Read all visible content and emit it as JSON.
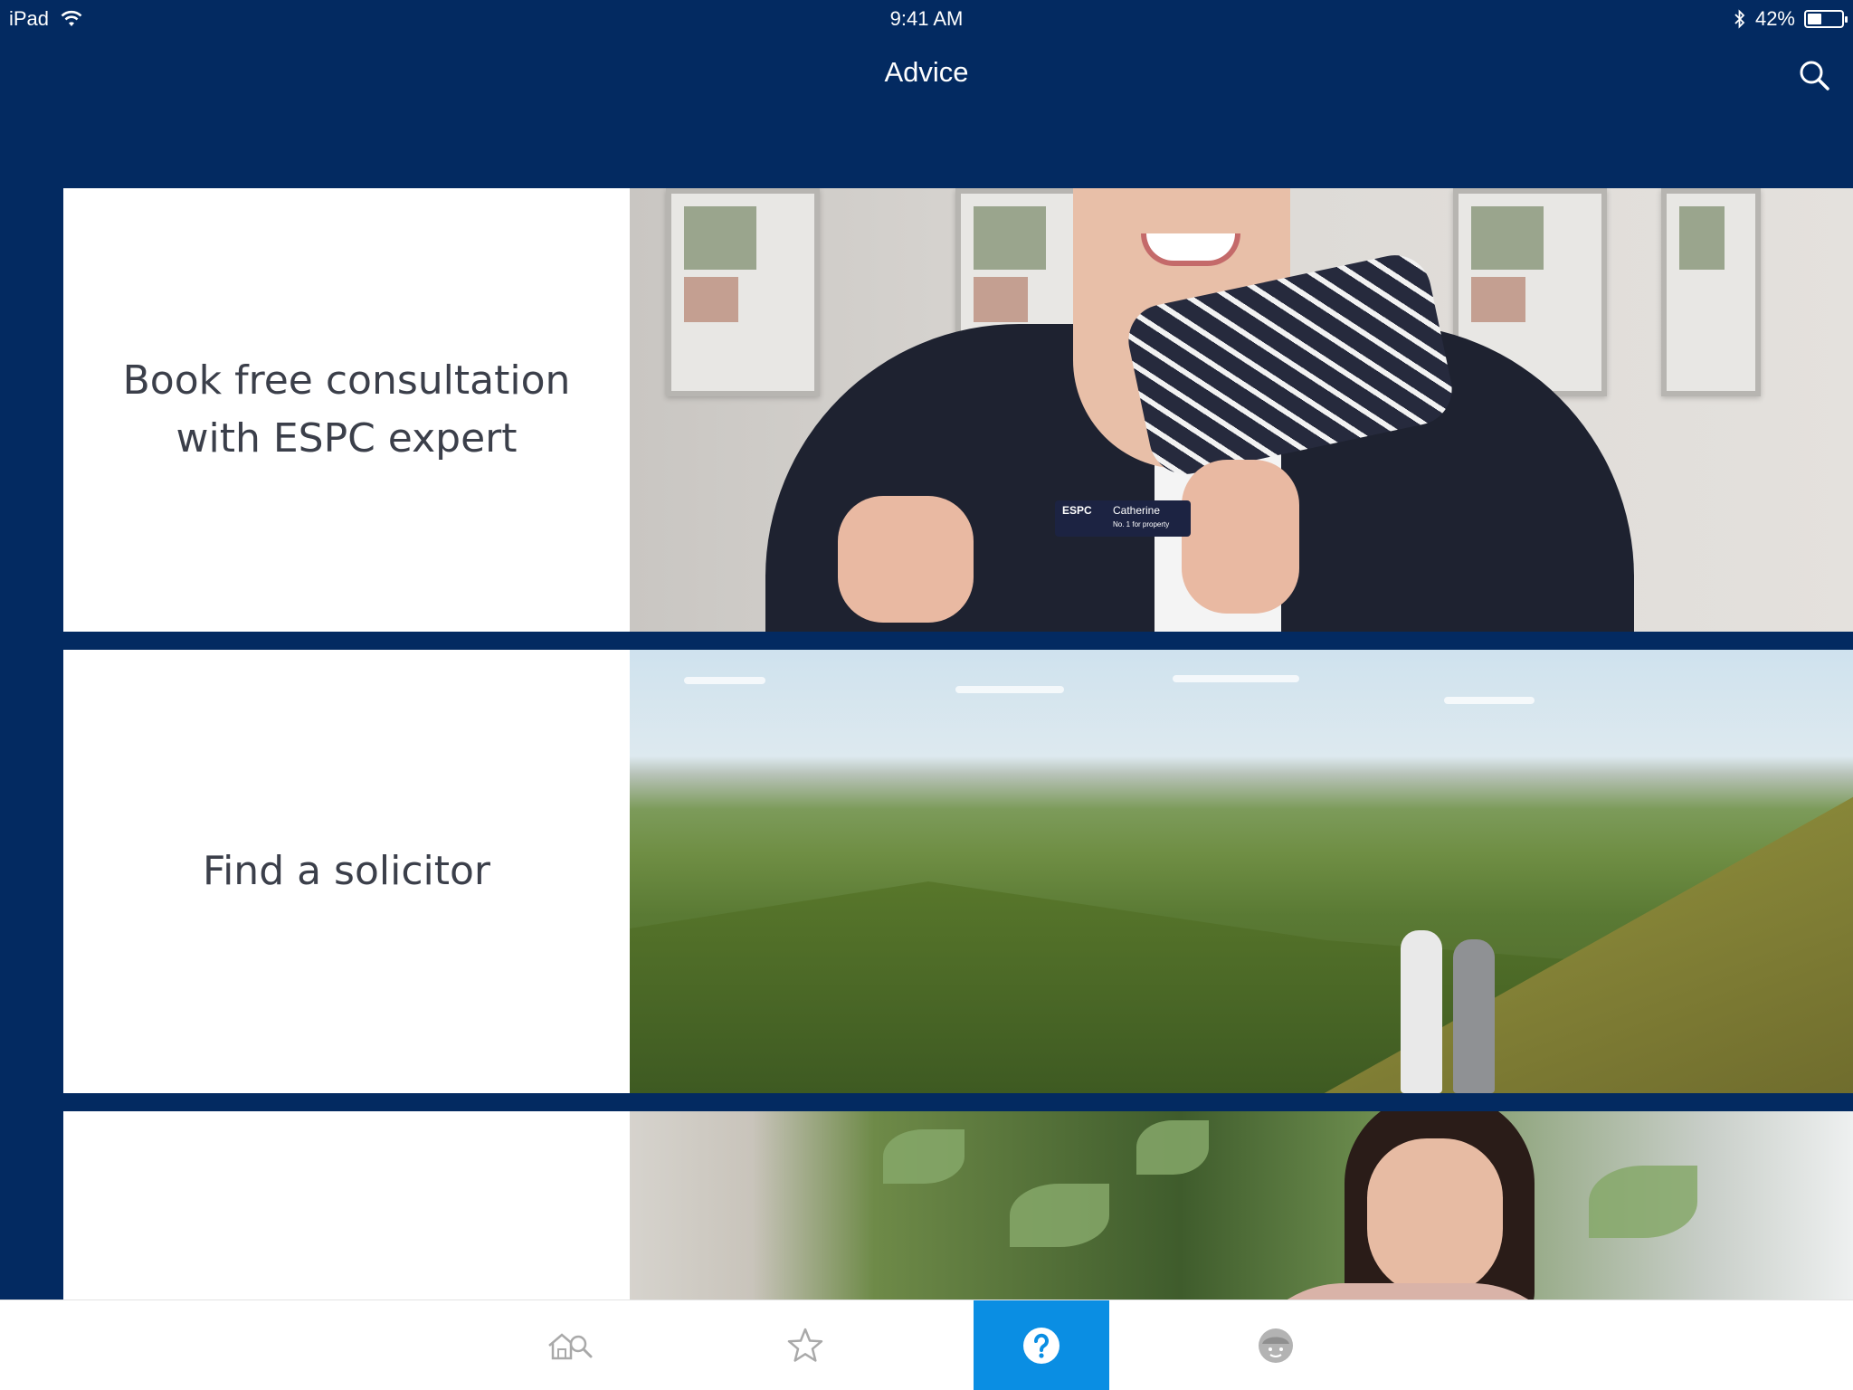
{
  "status_bar": {
    "device": "iPad",
    "time": "9:41 AM",
    "battery": "42%",
    "battery_level": 0.42
  },
  "nav": {
    "title": "Advice",
    "search_icon": "search-icon"
  },
  "cards": [
    {
      "label": "Book free consultation with ESPC expert",
      "image": "consultant-photo"
    },
    {
      "label": "Find a solicitor",
      "image": "landscape-photo"
    },
    {
      "label": "",
      "image": "woman-on-phone-photo"
    }
  ],
  "badge": {
    "brand": "ESPC",
    "name": "Catherine",
    "tagline": "No. 1 for property"
  },
  "tab_bar": {
    "tabs": [
      {
        "icon": "property-search-icon",
        "active": false
      },
      {
        "icon": "star-icon",
        "active": false
      },
      {
        "icon": "help-icon",
        "active": true
      },
      {
        "icon": "profile-icon",
        "active": false
      }
    ],
    "active_color": "#0a8ee3",
    "inactive_color": "#a9a9a9"
  },
  "colors": {
    "background": "#032a61",
    "card_text": "#3b3f4a"
  }
}
